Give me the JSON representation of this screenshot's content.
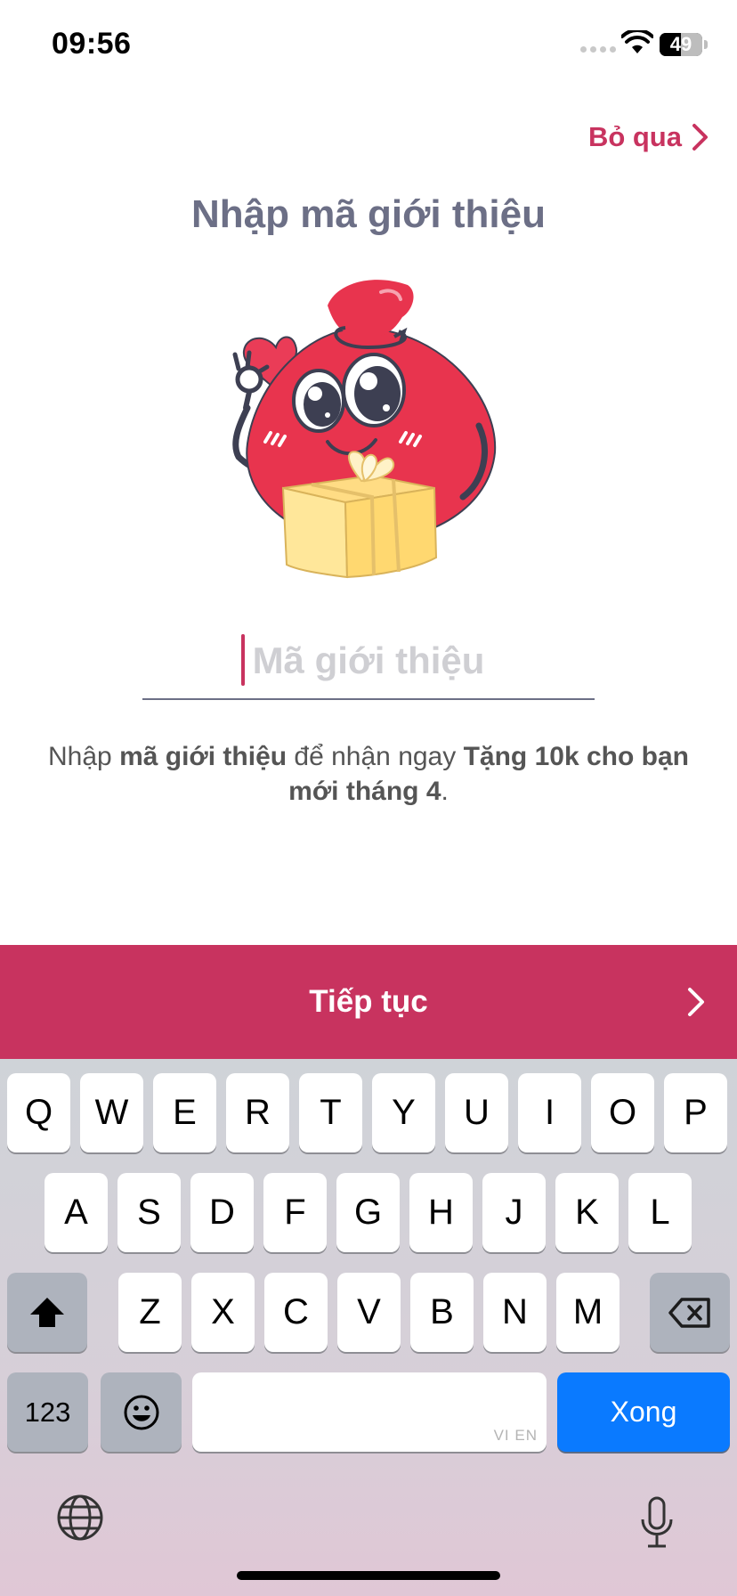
{
  "status_bar": {
    "time": "09:56",
    "battery_level": "49"
  },
  "header": {
    "skip_label": "Bỏ qua",
    "title": "Nhập mã giới thiệu"
  },
  "referral_field": {
    "placeholder": "Mã giới thiệu",
    "value": ""
  },
  "hint": {
    "part1": "Nhập ",
    "bold1": "mã giới thiệu",
    "part2": " để nhận ngay ",
    "bold2": "Tặng 10k cho bạn mới tháng 4",
    "part3": "."
  },
  "continue_button": {
    "label": "Tiếp tục"
  },
  "keyboard": {
    "row1": [
      "Q",
      "W",
      "E",
      "R",
      "T",
      "Y",
      "U",
      "I",
      "O",
      "P"
    ],
    "row2": [
      "A",
      "S",
      "D",
      "F",
      "G",
      "H",
      "J",
      "K",
      "L"
    ],
    "row3": [
      "Z",
      "X",
      "C",
      "V",
      "B",
      "N",
      "M"
    ],
    "numbers_label": "123",
    "space_hint": "VI EN",
    "done_label": "Xong"
  },
  "colors": {
    "accent": "#c8335f",
    "title": "#6c6f86",
    "keyboard_done": "#0a7aff"
  }
}
